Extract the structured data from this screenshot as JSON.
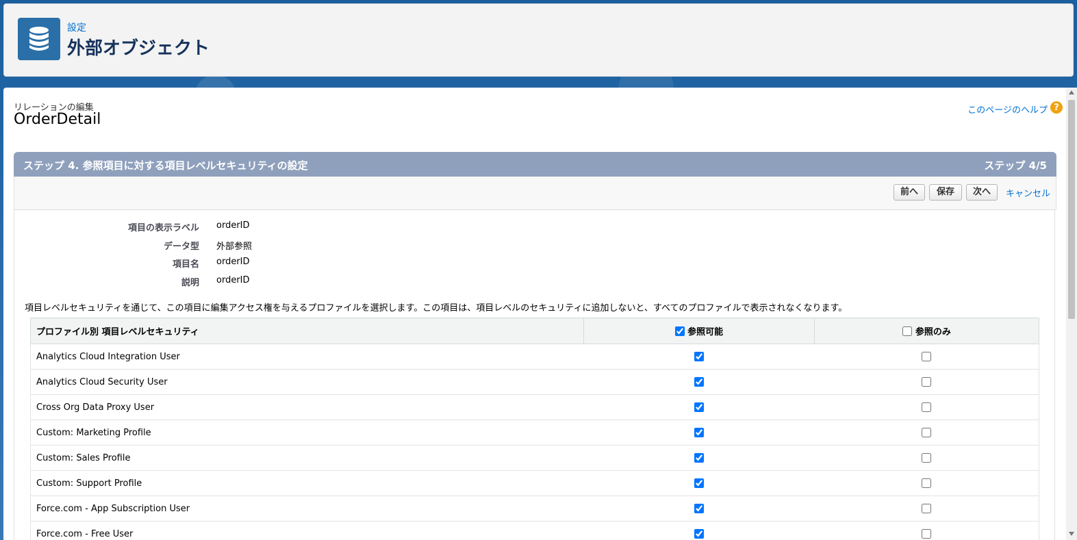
{
  "header": {
    "breadcrumb": "設定",
    "title": "外部オブジェクト",
    "icon": "database-icon"
  },
  "record": {
    "edit_label": "リレーションの編集",
    "name": "OrderDetail",
    "help_link": "このページのヘルプ"
  },
  "step": {
    "title": "ステップ 4. 参照項目に対する項目レベルセキュリティの設定",
    "count": "ステップ 4/5"
  },
  "buttons": {
    "prev": "前へ",
    "save": "保存",
    "next": "次へ",
    "cancel": "キャンセル"
  },
  "details": [
    {
      "label": "項目の表示ラベル",
      "value": "orderID"
    },
    {
      "label": "データ型",
      "value": "外部参照"
    },
    {
      "label": "項目名",
      "value": "orderID"
    },
    {
      "label": "説明",
      "value": "orderID"
    }
  ],
  "instructions": "項目レベルセキュリティを通じて、この項目に編集アクセス権を与えるプロファイルを選択します。この項目は、項目レベルのセキュリティに追加しないと、すべてのプロファイルで表示されなくなります。",
  "table": {
    "headers": {
      "profile": "プロファイル別 項目レベルセキュリティ",
      "readable": "参照可能",
      "readonly": "参照のみ"
    },
    "header_readable_checked": true,
    "header_readonly_checked": false,
    "rows": [
      {
        "profile": "Analytics Cloud Integration User",
        "readable": true,
        "readonly": false
      },
      {
        "profile": "Analytics Cloud Security User",
        "readable": true,
        "readonly": false
      },
      {
        "profile": "Cross Org Data Proxy User",
        "readable": true,
        "readonly": false
      },
      {
        "profile": "Custom: Marketing Profile",
        "readable": true,
        "readonly": false
      },
      {
        "profile": "Custom: Sales Profile",
        "readable": true,
        "readonly": false
      },
      {
        "profile": "Custom: Support Profile",
        "readable": true,
        "readonly": false
      },
      {
        "profile": "Force.com - App Subscription User",
        "readable": true,
        "readonly": false
      },
      {
        "profile": "Force.com - Free User",
        "readable": true,
        "readonly": false
      }
    ]
  },
  "colors": {
    "header_icon_bg": "#2a6fa8",
    "step_bar": "#8fa0bd",
    "link": "#0070d2",
    "help_icon": "#f2a20e"
  }
}
